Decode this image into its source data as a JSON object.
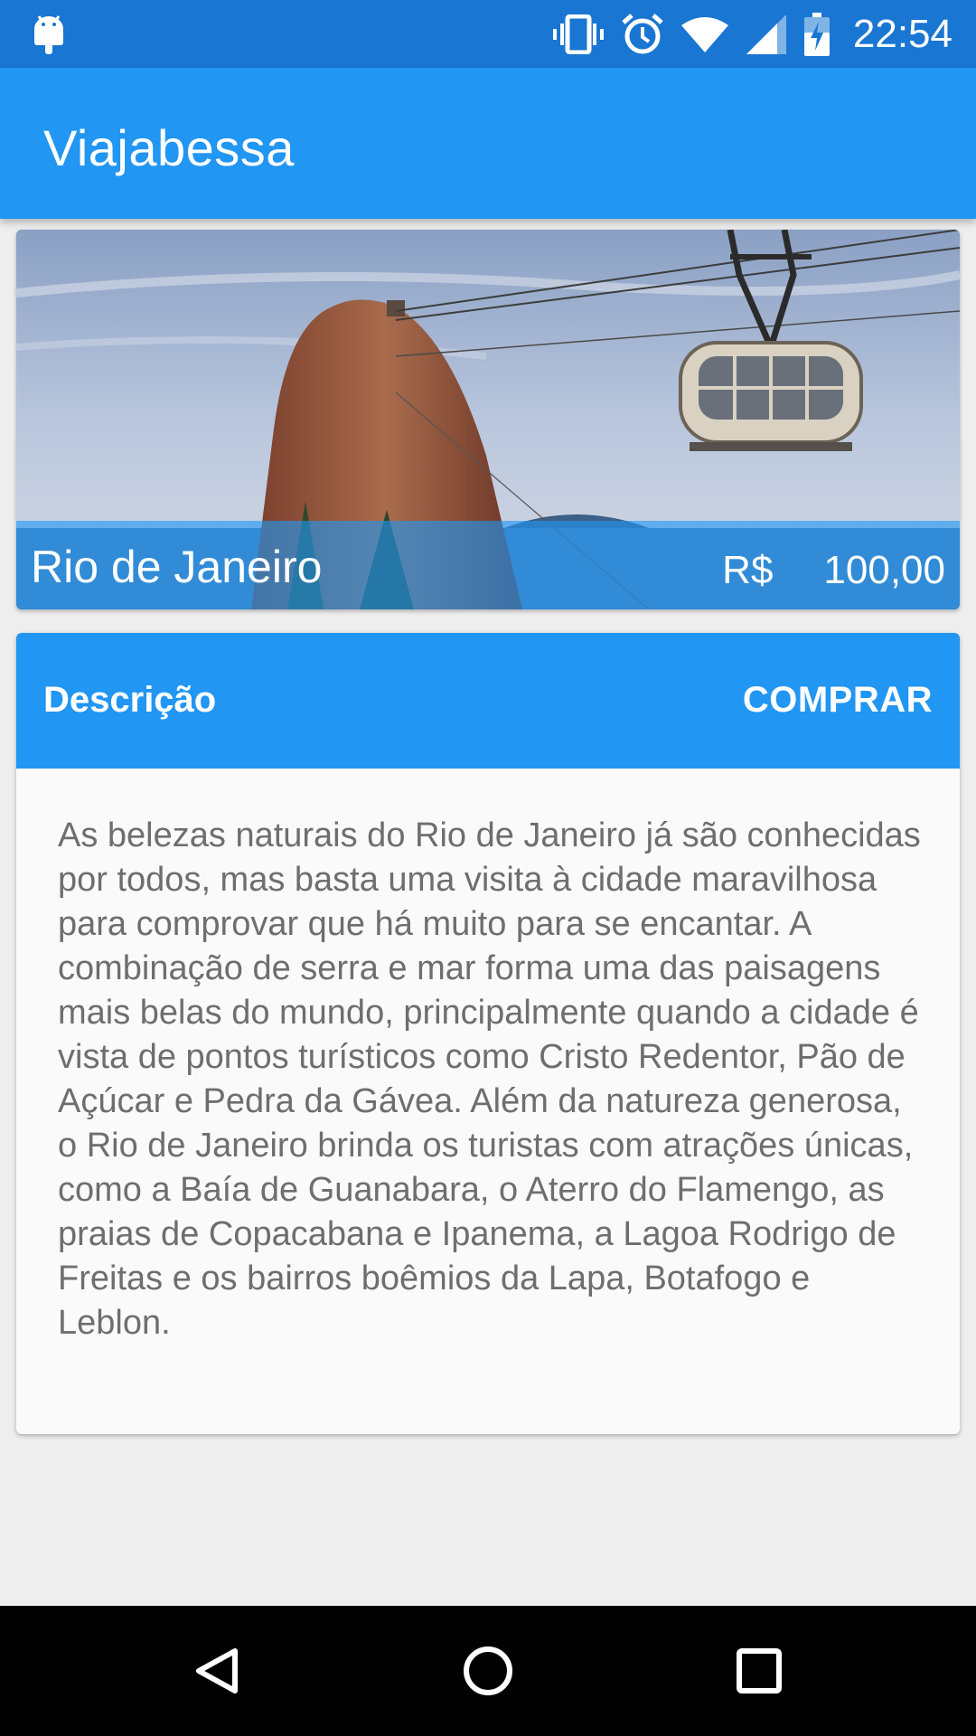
{
  "status_bar": {
    "time": "22:54",
    "icons": [
      "android-icon",
      "vibrate-icon",
      "alarm-icon",
      "wifi-icon",
      "signal-icon",
      "battery-charging-icon"
    ]
  },
  "app_bar": {
    "title": "Viajabessa"
  },
  "destination": {
    "city": "Rio de Janeiro",
    "currency": "R$",
    "price": "100,00"
  },
  "description": {
    "label": "Descrição",
    "buy_label": "COMPRAR",
    "text": "As belezas naturais do Rio de Janeiro já são conhecidas por todos, mas basta uma visita à cidade maravilhosa para comprovar que há muito para se encantar. A combinação de serra e mar forma uma das paisagens mais belas do mundo, principalmente quando a cidade é vista de pontos turísticos como Cristo Redentor, Pão de Açúcar e Pedra da Gávea. Além da natureza generosa, o Rio de Janeiro brinda os turistas com atrações únicas, como a Baía de Guanabara, o Aterro do Flamengo, as praias de Copacabana e Ipanema, a Lagoa Rodrigo de Freitas e os bairros boêmios da Lapa, Botafogo e Leblon."
  },
  "nav_bar": {
    "icons": [
      "back-icon",
      "home-icon",
      "recents-icon"
    ]
  },
  "colors": {
    "status_bar": "#1976d2",
    "primary": "#2196f3",
    "background": "#eeeeee",
    "card": "#fafafa",
    "body_text": "#6e6e6e"
  }
}
